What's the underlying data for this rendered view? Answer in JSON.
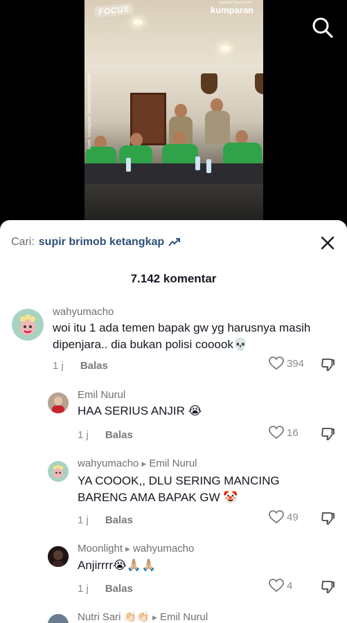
{
  "video": {
    "logo_left": "FOCUS",
    "logo_right": "kumparan",
    "logo_right_tagline": "Aspiratif Tepat Terkini",
    "credit": "Aset: Instagram @divisipropampolri"
  },
  "search_icon": "search-icon",
  "sheet": {
    "search_prefix": "Cari:",
    "search_query": "supir brimob ketangkap",
    "comment_count": "7.142 komentar"
  },
  "comments": [
    {
      "user": "wahyumacho",
      "reply_to": "",
      "text": "woi itu 1 ada temen bapak gw yg harusnya masih dipenjara.. dia bukan polisi cooook💀",
      "time": "1 j",
      "reply_label": "Balas",
      "likes": "394"
    },
    {
      "user": "Emil Nurul",
      "reply_to": "",
      "text": "HAA SERIUS ANJIR 😭",
      "time": "1 j",
      "reply_label": "Balas",
      "likes": "16"
    },
    {
      "user": "wahyumacho",
      "reply_to": "Emil Nurul",
      "text": "YA COOOK,, DLU SERING MANCING BARENG AMA BAPAK GW 🤡",
      "time": "1 j",
      "reply_label": "Balas",
      "likes": "49"
    },
    {
      "user": "Moonlight",
      "reply_to": "wahyumacho",
      "text": "Anjirrrr😭🙏🏼🙏🏼",
      "time": "1 j",
      "reply_label": "Balas",
      "likes": "4"
    },
    {
      "user": "Nutri Sari 👏🏻👏🏻",
      "reply_to": "Emil Nurul",
      "text": "",
      "time": "",
      "reply_label": "",
      "likes": ""
    }
  ],
  "colors": {
    "sheet_bg": "#ffffff",
    "text_primary": "#161823",
    "text_secondary": "#8a8a8a",
    "search_query": "#2f4f7a"
  }
}
